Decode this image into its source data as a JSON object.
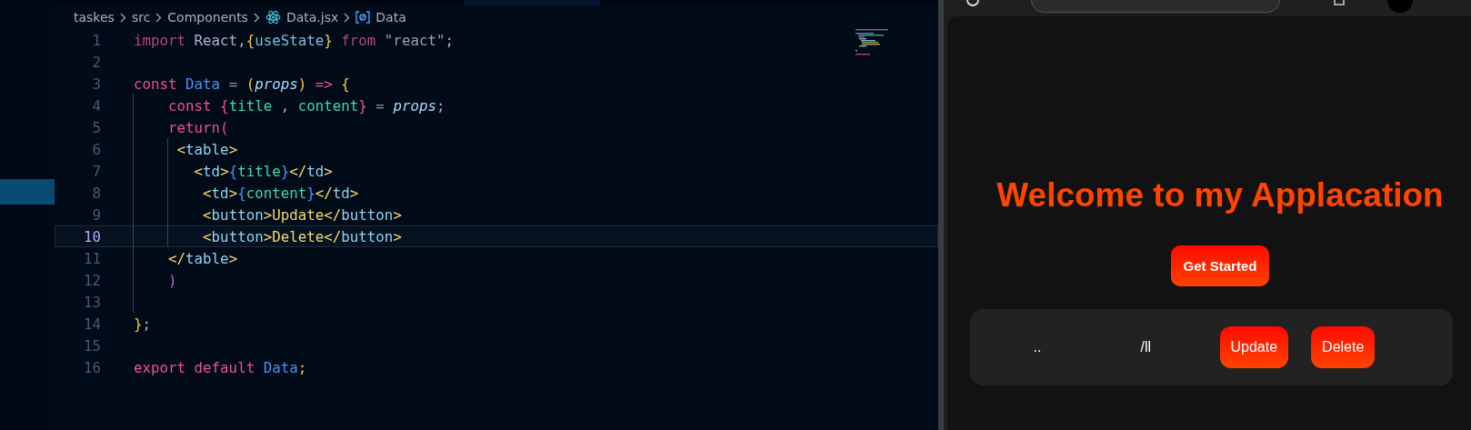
{
  "breadcrumb": [
    {
      "label": "taskes",
      "kind": "folder"
    },
    {
      "label": "src",
      "kind": "folder"
    },
    {
      "label": "Components",
      "kind": "folder"
    },
    {
      "label": "Data.jsx",
      "kind": "react-file"
    },
    {
      "label": "Data",
      "kind": "symbol"
    }
  ],
  "editor": {
    "lines": [
      {
        "number": "1",
        "selected": false,
        "tokens": [
          {
            "text": "import ",
            "kind": "kw2"
          },
          {
            "text": "React,",
            "kind": "plain"
          },
          {
            "text": "{",
            "kind": "brace"
          },
          {
            "text": "useState",
            "kind": "fn"
          },
          {
            "text": "}",
            "kind": "brace"
          },
          {
            "text": " from ",
            "kind": "kw2"
          },
          {
            "text": "\"react\"",
            "kind": "string"
          },
          {
            "text": ";",
            "kind": "plain"
          }
        ]
      },
      {
        "number": "2",
        "selected": false
      },
      {
        "number": "3",
        "selected": false,
        "tokens": [
          {
            "text": "const ",
            "kind": "kw"
          },
          {
            "text": "Data",
            "kind": "ident"
          },
          {
            "text": " = ",
            "kind": "punct"
          },
          {
            "text": "(",
            "kind": "brace"
          },
          {
            "text": "props",
            "kind": "param"
          },
          {
            "text": ")",
            "kind": "brace"
          },
          {
            "text": " => ",
            "kind": "kw"
          },
          {
            "text": "{",
            "kind": "brace"
          }
        ]
      },
      {
        "number": "4",
        "selected": false,
        "tokens": [
          {
            "text": "    const ",
            "kind": "kw"
          },
          {
            "text": "{",
            "kind": "kw"
          },
          {
            "text": "title",
            "kind": "var"
          },
          {
            "text": " , ",
            "kind": "plain"
          },
          {
            "text": "content",
            "kind": "var"
          },
          {
            "text": "}",
            "kind": "kw"
          },
          {
            "text": " = ",
            "kind": "punct"
          },
          {
            "text": "props",
            "kind": "param"
          },
          {
            "text": ";",
            "kind": "plain"
          }
        ]
      },
      {
        "number": "5",
        "selected": false,
        "tokens": [
          {
            "text": "    return(",
            "kind": "kw"
          }
        ]
      },
      {
        "number": "6",
        "selected": false,
        "tokens": [
          {
            "text": "     <",
            "kind": "tagb"
          },
          {
            "text": "table",
            "kind": "tag"
          },
          {
            "text": ">",
            "kind": "tagb"
          }
        ]
      },
      {
        "number": "7",
        "selected": false,
        "tokens": [
          {
            "text": "       <",
            "kind": "tagb"
          },
          {
            "text": "td",
            "kind": "tag"
          },
          {
            "text": ">",
            "kind": "tagb"
          },
          {
            "text": "{",
            "kind": "jsxb"
          },
          {
            "text": "title",
            "kind": "var"
          },
          {
            "text": "}",
            "kind": "jsxb"
          },
          {
            "text": "</",
            "kind": "tagb"
          },
          {
            "text": "td",
            "kind": "tag"
          },
          {
            "text": ">",
            "kind": "tagb"
          }
        ]
      },
      {
        "number": "8",
        "selected": false,
        "tokens": [
          {
            "text": "        <",
            "kind": "tagb"
          },
          {
            "text": "td",
            "kind": "tag"
          },
          {
            "text": ">",
            "kind": "tagb"
          },
          {
            "text": "{",
            "kind": "jsxb"
          },
          {
            "text": "content",
            "kind": "var"
          },
          {
            "text": "}",
            "kind": "jsxb"
          },
          {
            "text": "</",
            "kind": "tagb"
          },
          {
            "text": "td",
            "kind": "tag"
          },
          {
            "text": ">",
            "kind": "tagb"
          }
        ]
      },
      {
        "number": "9",
        "selected": false,
        "tokens": [
          {
            "text": "        <",
            "kind": "tagb"
          },
          {
            "text": "button",
            "kind": "tag"
          },
          {
            "text": ">",
            "kind": "tagb"
          },
          {
            "text": "Update",
            "kind": "jsxtext"
          },
          {
            "text": "</",
            "kind": "tagb"
          },
          {
            "text": "button",
            "kind": "tag"
          },
          {
            "text": ">",
            "kind": "tagb"
          }
        ]
      },
      {
        "number": "10",
        "selected": true,
        "tokens": [
          {
            "text": "        <",
            "kind": "tagb"
          },
          {
            "text": "button",
            "kind": "tag"
          },
          {
            "text": ">",
            "kind": "tagb"
          },
          {
            "text": "Delete",
            "kind": "jsxtext"
          },
          {
            "text": "</",
            "kind": "tagb"
          },
          {
            "text": "button",
            "kind": "tag"
          },
          {
            "text": ">",
            "kind": "tagb"
          }
        ]
      },
      {
        "number": "11",
        "selected": false,
        "tokens": [
          {
            "text": "    </",
            "kind": "tagb"
          },
          {
            "text": "table",
            "kind": "tag"
          },
          {
            "text": ">",
            "kind": "tagb"
          }
        ]
      },
      {
        "number": "12",
        "selected": false,
        "tokens": [
          {
            "text": "    )",
            "kind": "kw3"
          }
        ]
      },
      {
        "number": "13",
        "selected": false
      },
      {
        "number": "14",
        "selected": false,
        "tokens": [
          {
            "text": "}",
            "kind": "brace"
          },
          {
            "text": ";",
            "kind": "plain"
          }
        ]
      },
      {
        "number": "15",
        "selected": false
      },
      {
        "number": "16",
        "selected": false,
        "tokens": [
          {
            "text": "export default ",
            "kind": "kw"
          },
          {
            "text": "Data",
            "kind": "ident"
          },
          {
            "text": ";",
            "kind": "brace"
          }
        ]
      }
    ]
  },
  "page": {
    "heading": "Welcome to my Applacation",
    "cta": "Get Started",
    "row": {
      "cells": [
        "..",
        "/ll"
      ],
      "buttons": [
        "Update",
        "Delete"
      ]
    }
  }
}
